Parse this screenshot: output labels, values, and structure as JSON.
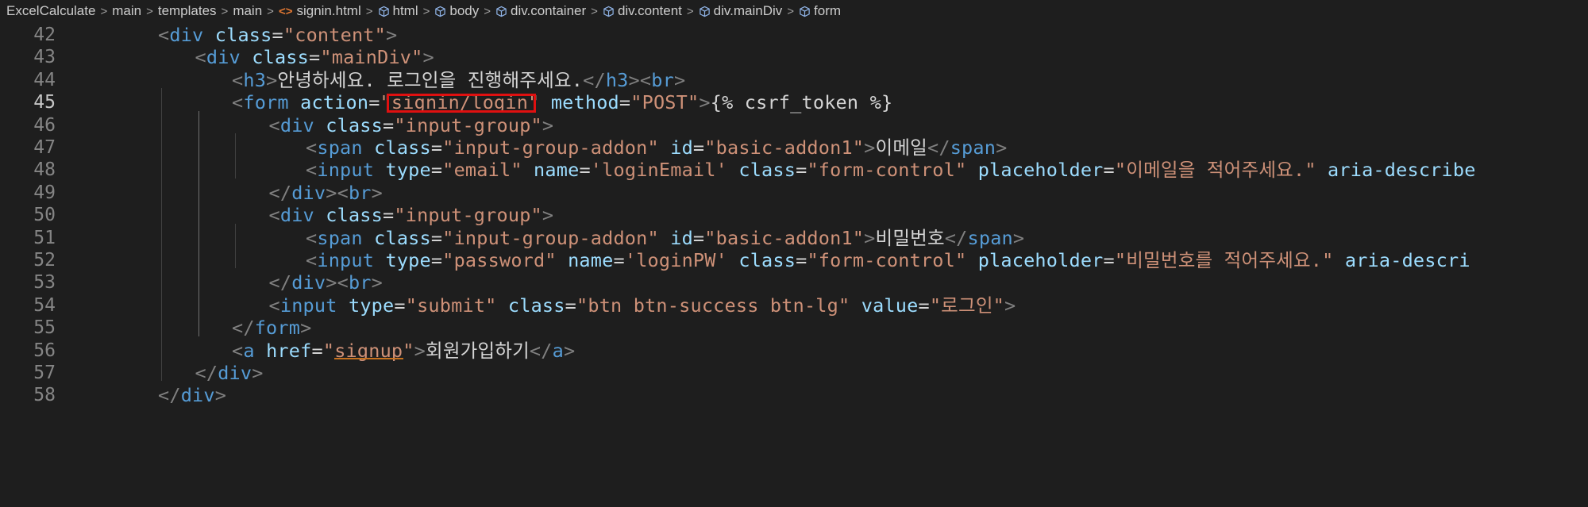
{
  "breadcrumb": {
    "items": [
      "ExcelCalculate",
      "main",
      "templates",
      "main",
      "signin.html",
      "html",
      "body",
      "div.container",
      "div.content",
      "div.mainDiv",
      "form"
    ],
    "file_icon": "html-file-icon",
    "symbol_icon": "cube-icon",
    "separator": ">"
  },
  "editor": {
    "active_line": 45,
    "lines": [
      {
        "num": "42",
        "indent": 2,
        "tokens": [
          [
            "punc",
            "<"
          ],
          [
            "tag",
            "div"
          ],
          [
            "text",
            " "
          ],
          [
            "attr",
            "class"
          ],
          [
            "text",
            "="
          ],
          [
            "str",
            "\"content\""
          ],
          [
            "punc",
            ">"
          ]
        ]
      },
      {
        "num": "43",
        "indent": 3,
        "tokens": [
          [
            "punc",
            "<"
          ],
          [
            "tag",
            "div"
          ],
          [
            "text",
            " "
          ],
          [
            "attr",
            "class"
          ],
          [
            "text",
            "="
          ],
          [
            "str",
            "\"mainDiv\""
          ],
          [
            "punc",
            ">"
          ]
        ]
      },
      {
        "num": "44",
        "indent": 4,
        "tokens": [
          [
            "punc",
            "<"
          ],
          [
            "tag",
            "h3"
          ],
          [
            "punc",
            ">"
          ],
          [
            "text",
            "안녕하세요. 로그인을 진행해주세요."
          ],
          [
            "punc",
            "</"
          ],
          [
            "tag",
            "h3"
          ],
          [
            "punc",
            "><"
          ],
          [
            "tag",
            "br"
          ],
          [
            "punc",
            ">"
          ]
        ]
      },
      {
        "num": "45",
        "indent": 4,
        "tokens": [
          [
            "punc",
            "<"
          ],
          [
            "tag",
            "form"
          ],
          [
            "text",
            " "
          ],
          [
            "attr",
            "action"
          ],
          [
            "text",
            "="
          ],
          [
            "str",
            "\"signin/login\""
          ],
          [
            "text",
            " "
          ],
          [
            "attr",
            "method"
          ],
          [
            "text",
            "="
          ],
          [
            "str",
            "\"POST\""
          ],
          [
            "punc",
            ">"
          ],
          [
            "tmpl",
            "{% csrf_token %}"
          ]
        ]
      },
      {
        "num": "46",
        "indent": 5,
        "tokens": [
          [
            "punc",
            "<"
          ],
          [
            "tag",
            "div"
          ],
          [
            "text",
            " "
          ],
          [
            "attr",
            "class"
          ],
          [
            "text",
            "="
          ],
          [
            "str",
            "\"input-group\""
          ],
          [
            "punc",
            ">"
          ]
        ]
      },
      {
        "num": "47",
        "indent": 6,
        "tokens": [
          [
            "punc",
            "<"
          ],
          [
            "tag",
            "span"
          ],
          [
            "text",
            " "
          ],
          [
            "attr",
            "class"
          ],
          [
            "text",
            "="
          ],
          [
            "str",
            "\"input-group-addon\""
          ],
          [
            "text",
            " "
          ],
          [
            "attr",
            "id"
          ],
          [
            "text",
            "="
          ],
          [
            "str",
            "\"basic-addon1\""
          ],
          [
            "punc",
            ">"
          ],
          [
            "text",
            "이메일"
          ],
          [
            "punc",
            "</"
          ],
          [
            "tag",
            "span"
          ],
          [
            "punc",
            ">"
          ]
        ]
      },
      {
        "num": "48",
        "indent": 6,
        "tokens": [
          [
            "punc",
            "<"
          ],
          [
            "tag",
            "input"
          ],
          [
            "text",
            " "
          ],
          [
            "attr",
            "type"
          ],
          [
            "text",
            "="
          ],
          [
            "str",
            "\"email\""
          ],
          [
            "text",
            " "
          ],
          [
            "attr",
            "name"
          ],
          [
            "text",
            "="
          ],
          [
            "str",
            "'loginEmail'"
          ],
          [
            "text",
            " "
          ],
          [
            "attr",
            "class"
          ],
          [
            "text",
            "="
          ],
          [
            "str",
            "\"form-control\""
          ],
          [
            "text",
            " "
          ],
          [
            "attr",
            "placeholder"
          ],
          [
            "text",
            "="
          ],
          [
            "str",
            "\"이메일을 적어주세요.\""
          ],
          [
            "text",
            " "
          ],
          [
            "attr",
            "aria-describe"
          ]
        ]
      },
      {
        "num": "49",
        "indent": 5,
        "tokens": [
          [
            "punc",
            "</"
          ],
          [
            "tag",
            "div"
          ],
          [
            "punc",
            "><"
          ],
          [
            "tag",
            "br"
          ],
          [
            "punc",
            ">"
          ]
        ]
      },
      {
        "num": "50",
        "indent": 5,
        "tokens": [
          [
            "punc",
            "<"
          ],
          [
            "tag",
            "div"
          ],
          [
            "text",
            " "
          ],
          [
            "attr",
            "class"
          ],
          [
            "text",
            "="
          ],
          [
            "str",
            "\"input-group\""
          ],
          [
            "punc",
            ">"
          ]
        ]
      },
      {
        "num": "51",
        "indent": 6,
        "tokens": [
          [
            "punc",
            "<"
          ],
          [
            "tag",
            "span"
          ],
          [
            "text",
            " "
          ],
          [
            "attr",
            "class"
          ],
          [
            "text",
            "="
          ],
          [
            "str",
            "\"input-group-addon\""
          ],
          [
            "text",
            " "
          ],
          [
            "attr",
            "id"
          ],
          [
            "text",
            "="
          ],
          [
            "str",
            "\"basic-addon1\""
          ],
          [
            "punc",
            ">"
          ],
          [
            "text",
            "비밀번호"
          ],
          [
            "punc",
            "</"
          ],
          [
            "tag",
            "span"
          ],
          [
            "punc",
            ">"
          ]
        ]
      },
      {
        "num": "52",
        "indent": 6,
        "tokens": [
          [
            "punc",
            "<"
          ],
          [
            "tag",
            "input"
          ],
          [
            "text",
            " "
          ],
          [
            "attr",
            "type"
          ],
          [
            "text",
            "="
          ],
          [
            "str",
            "\"password\""
          ],
          [
            "text",
            " "
          ],
          [
            "attr",
            "name"
          ],
          [
            "text",
            "="
          ],
          [
            "str",
            "'loginPW'"
          ],
          [
            "text",
            " "
          ],
          [
            "attr",
            "class"
          ],
          [
            "text",
            "="
          ],
          [
            "str",
            "\"form-control\""
          ],
          [
            "text",
            " "
          ],
          [
            "attr",
            "placeholder"
          ],
          [
            "text",
            "="
          ],
          [
            "str",
            "\"비밀번호를 적어주세요.\""
          ],
          [
            "text",
            " "
          ],
          [
            "attr",
            "aria-descri"
          ]
        ]
      },
      {
        "num": "53",
        "indent": 5,
        "tokens": [
          [
            "punc",
            "</"
          ],
          [
            "tag",
            "div"
          ],
          [
            "punc",
            "><"
          ],
          [
            "tag",
            "br"
          ],
          [
            "punc",
            ">"
          ]
        ]
      },
      {
        "num": "54",
        "indent": 5,
        "tokens": [
          [
            "punc",
            "<"
          ],
          [
            "tag",
            "input"
          ],
          [
            "text",
            " "
          ],
          [
            "attr",
            "type"
          ],
          [
            "text",
            "="
          ],
          [
            "str",
            "\"submit\""
          ],
          [
            "text",
            " "
          ],
          [
            "attr",
            "class"
          ],
          [
            "text",
            "="
          ],
          [
            "str",
            "\"btn btn-success btn-lg\""
          ],
          [
            "text",
            " "
          ],
          [
            "attr",
            "value"
          ],
          [
            "text",
            "="
          ],
          [
            "str",
            "\"로그인\""
          ],
          [
            "punc",
            ">"
          ]
        ]
      },
      {
        "num": "55",
        "indent": 4,
        "tokens": [
          [
            "punc",
            "</"
          ],
          [
            "tag",
            "form"
          ],
          [
            "punc",
            ">"
          ]
        ]
      },
      {
        "num": "56",
        "indent": 4,
        "tokens": [
          [
            "punc",
            "<"
          ],
          [
            "tag",
            "a"
          ],
          [
            "text",
            " "
          ],
          [
            "attr",
            "href"
          ],
          [
            "text",
            "="
          ],
          [
            "str",
            "\"signup\""
          ],
          [
            "punc",
            ">"
          ],
          [
            "text",
            "회원가입하기"
          ],
          [
            "punc",
            "</"
          ],
          [
            "tag",
            "a"
          ],
          [
            "punc",
            ">"
          ]
        ]
      },
      {
        "num": "57",
        "indent": 3,
        "tokens": [
          [
            "punc",
            "</"
          ],
          [
            "tag",
            "div"
          ],
          [
            "punc",
            ">"
          ]
        ]
      },
      {
        "num": "58",
        "indent": 2,
        "tokens": [
          [
            "punc",
            "</"
          ],
          [
            "tag",
            "div"
          ],
          [
            "punc",
            ">"
          ]
        ]
      }
    ]
  },
  "colors": {
    "background": "#1e1e1e",
    "tag": "#569cd6",
    "attribute": "#9cdcfe",
    "string": "#ce9178",
    "punctuation": "#808080",
    "text": "#d4d4d4",
    "highlight_box": "#e01010",
    "link_underline": "#c7721f"
  },
  "annotation": {
    "highlighted_text": "signin/login"
  }
}
